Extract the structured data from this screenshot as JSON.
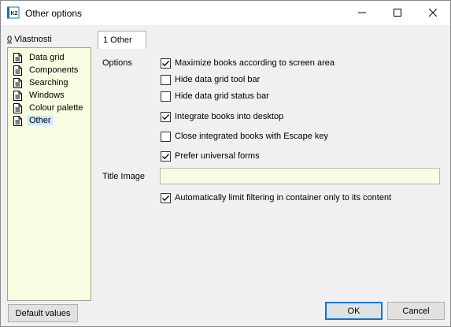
{
  "window": {
    "title": "Other options",
    "app_icon": "k2-app-icon",
    "controls": [
      "minimize-icon",
      "maximize-icon",
      "close-icon"
    ]
  },
  "left_panel": {
    "tab_number": "0",
    "tab_label": " Vlastnosti",
    "items": [
      {
        "label": "Data grid",
        "selected": false
      },
      {
        "label": "Components",
        "selected": false
      },
      {
        "label": "Searching",
        "selected": false
      },
      {
        "label": "Windows",
        "selected": false
      },
      {
        "label": "Colour palette",
        "selected": false
      },
      {
        "label": "Other",
        "selected": true
      }
    ],
    "default_values_button": "Default values"
  },
  "main": {
    "tab_label": "1 Other",
    "options_label": "Options",
    "checkboxes": [
      {
        "label": "Maximize books according to screen area",
        "checked": true
      },
      {
        "label": "Hide data grid tool bar",
        "checked": false
      },
      {
        "label": "Hide data grid status bar",
        "checked": false
      },
      {
        "label": "Integrate books into desktop",
        "checked": true
      },
      {
        "label": "Close integrated books with Escape key",
        "checked": false
      },
      {
        "label": "Prefer universal forms",
        "checked": true
      }
    ],
    "title_image_label": "Title Image",
    "title_image_value": "",
    "auto_limit": {
      "label": "Automatically limit filtering in container only to its content",
      "checked": true
    }
  },
  "footer": {
    "ok_label": "OK",
    "cancel_label": "Cancel"
  },
  "colors": {
    "tree_background": "#f7fde0",
    "selection": "#cce8ff",
    "field_background": "#fbfbe3",
    "focus_border": "#0078d7"
  }
}
